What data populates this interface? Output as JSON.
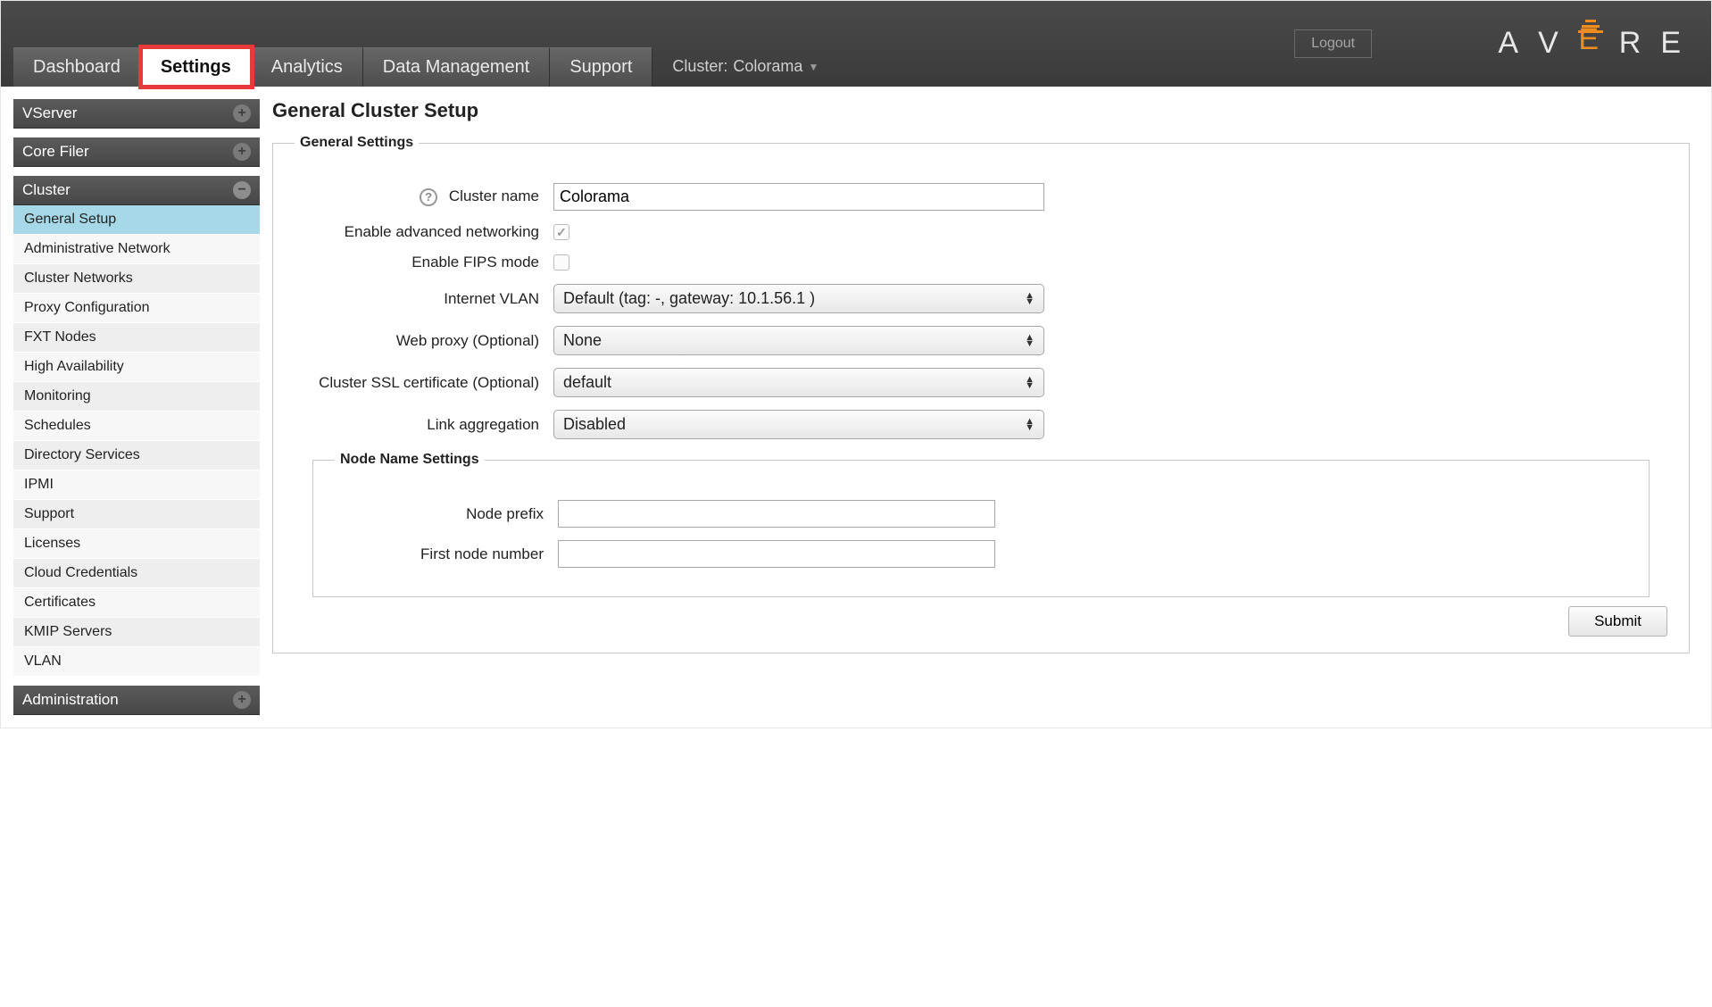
{
  "header": {
    "logout_label": "Logout",
    "cluster_prefix": "Cluster:",
    "cluster_name": "Colorama",
    "tabs": [
      "Dashboard",
      "Settings",
      "Analytics",
      "Data Management",
      "Support"
    ],
    "logo_letters": [
      "A",
      "V",
      "E",
      "R",
      "E"
    ]
  },
  "sidebar": {
    "sections": [
      {
        "title": "VServer",
        "expanded": false,
        "items": []
      },
      {
        "title": "Core Filer",
        "expanded": false,
        "items": []
      },
      {
        "title": "Cluster",
        "expanded": true,
        "items": [
          "General Setup",
          "Administrative Network",
          "Cluster Networks",
          "Proxy Configuration",
          "FXT Nodes",
          "High Availability",
          "Monitoring",
          "Schedules",
          "Directory Services",
          "IPMI",
          "Support",
          "Licenses",
          "Cloud Credentials",
          "Certificates",
          "KMIP Servers",
          "VLAN"
        ],
        "selected_index": 0
      },
      {
        "title": "Administration",
        "expanded": false,
        "items": []
      }
    ]
  },
  "main": {
    "page_title": "General Cluster Setup",
    "general_legend": "General Settings",
    "labels": {
      "cluster_name": "Cluster name",
      "adv_net": "Enable advanced networking",
      "fips": "Enable FIPS mode",
      "vlan": "Internet VLAN",
      "proxy": "Web proxy (Optional)",
      "ssl": "Cluster SSL certificate (Optional)",
      "link_agg": "Link aggregation",
      "node_prefix": "Node prefix",
      "first_node": "First node number"
    },
    "values": {
      "cluster_name": "Colorama",
      "adv_net_checked": true,
      "fips_checked": false,
      "vlan": "Default (tag: -, gateway: 10.1.56.1 )",
      "proxy": "None",
      "ssl": "default",
      "link_agg": "Disabled",
      "node_prefix": "",
      "first_node": ""
    },
    "node_legend": "Node Name Settings",
    "submit_label": "Submit"
  }
}
